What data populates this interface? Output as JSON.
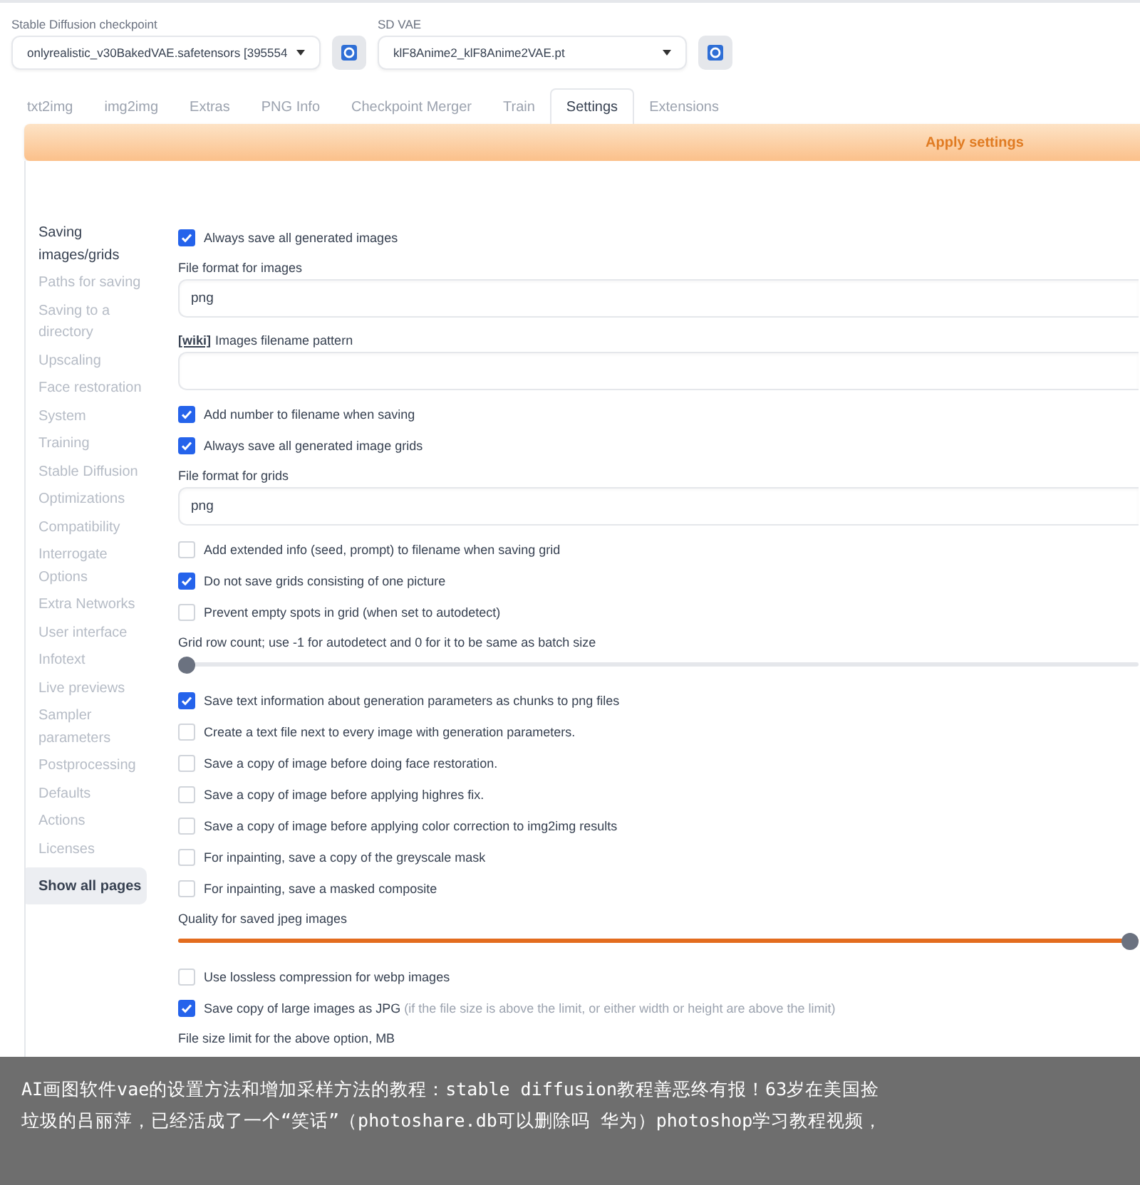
{
  "top": {
    "checkpoint": {
      "label": "Stable Diffusion checkpoint",
      "value": "onlyrealistic_v30BakedVAE.safetensors [395554"
    },
    "vae": {
      "label": "SD VAE",
      "value": "klF8Anime2_klF8Anime2VAE.pt"
    }
  },
  "tabs": [
    {
      "label": "txt2img",
      "selected": false
    },
    {
      "label": "img2img",
      "selected": false
    },
    {
      "label": "Extras",
      "selected": false
    },
    {
      "label": "PNG Info",
      "selected": false
    },
    {
      "label": "Checkpoint Merger",
      "selected": false
    },
    {
      "label": "Train",
      "selected": false
    },
    {
      "label": "Settings",
      "selected": true
    },
    {
      "label": "Extensions",
      "selected": false
    }
  ],
  "apply_button": "Apply settings",
  "sidebar": {
    "items": [
      {
        "label": "Saving images/grids",
        "selected": true
      },
      {
        "label": "Paths for saving",
        "selected": false
      },
      {
        "label": "Saving to a directory",
        "selected": false
      },
      {
        "label": "Upscaling",
        "selected": false
      },
      {
        "label": "Face restoration",
        "selected": false
      },
      {
        "label": "System",
        "selected": false
      },
      {
        "label": "Training",
        "selected": false
      },
      {
        "label": "Stable Diffusion",
        "selected": false
      },
      {
        "label": "Optimizations",
        "selected": false
      },
      {
        "label": "Compatibility",
        "selected": false
      },
      {
        "label": "Interrogate Options",
        "selected": false
      },
      {
        "label": "Extra Networks",
        "selected": false
      },
      {
        "label": "User interface",
        "selected": false
      },
      {
        "label": "Infotext",
        "selected": false
      },
      {
        "label": "Live previews",
        "selected": false
      },
      {
        "label": "Sampler parameters",
        "selected": false
      },
      {
        "label": "Postprocessing",
        "selected": false
      },
      {
        "label": "Defaults",
        "selected": false
      },
      {
        "label": "Actions",
        "selected": false
      },
      {
        "label": "Licenses",
        "selected": false
      }
    ],
    "show_all": "Show all pages"
  },
  "settings": [
    {
      "kind": "checkbox",
      "label": "Always save all generated images",
      "checked": true
    },
    {
      "kind": "field",
      "label": "File format for images",
      "value": "png"
    },
    {
      "kind": "field",
      "link": "[wiki]",
      "label": "Images filename pattern"
    },
    {
      "kind": "checkbox",
      "label": "Add number to filename when saving",
      "checked": true
    },
    {
      "kind": "checkbox",
      "label": "Always save all generated image grids",
      "checked": true
    },
    {
      "kind": "field",
      "label": "File format for grids",
      "value": "png"
    },
    {
      "kind": "checkbox",
      "label": "Add extended info (seed, prompt) to filename when saving grid",
      "checked": false
    },
    {
      "kind": "checkbox",
      "label": "Do not save grids consisting of one picture",
      "checked": true
    },
    {
      "kind": "checkbox",
      "label": "Prevent empty spots in grid (when set to autodetect)",
      "checked": false
    },
    {
      "kind": "slider",
      "label": "Grid row count; use -1 for autodetect and 0 for it to be same as batch size",
      "level": 0
    },
    {
      "kind": "checkbox",
      "label": "Save text information about generation parameters as chunks to png files",
      "checked": true
    },
    {
      "kind": "checkbox",
      "label": "Create a text file next to every image with generation parameters.",
      "checked": false
    },
    {
      "kind": "checkbox",
      "label": "Save a copy of image before doing face restoration.",
      "checked": false
    },
    {
      "kind": "checkbox",
      "label": "Save a copy of image before applying highres fix.",
      "checked": false
    },
    {
      "kind": "checkbox",
      "label": "Save a copy of image before applying color correction to img2img results",
      "checked": false
    },
    {
      "kind": "checkbox",
      "label": "For inpainting, save a copy of the greyscale mask",
      "checked": false
    },
    {
      "kind": "checkbox",
      "label": "For inpainting, save a masked composite",
      "checked": false
    },
    {
      "kind": "slider",
      "label": "Quality for saved jpeg images",
      "level": 1
    },
    {
      "kind": "checkbox",
      "label": "Use lossless compression for webp images",
      "checked": false
    },
    {
      "kind": "checkbox",
      "label": "Save copy of large images as JPG",
      "note": "(if the file size is above the limit, or either width or height are above the limit)",
      "checked": true
    },
    {
      "kind": "label",
      "label": "File size limit for the above option, MB"
    }
  ],
  "caption": "AI画图软件vae的设置方法和增加采样方法的教程：stable diffusion教程善恶终有报！63岁在美国捡垃圾的吕丽萍，已经活成了一个“笑话”（photoshare.db可以删除吗 华为）photoshop学习教程视频，"
}
